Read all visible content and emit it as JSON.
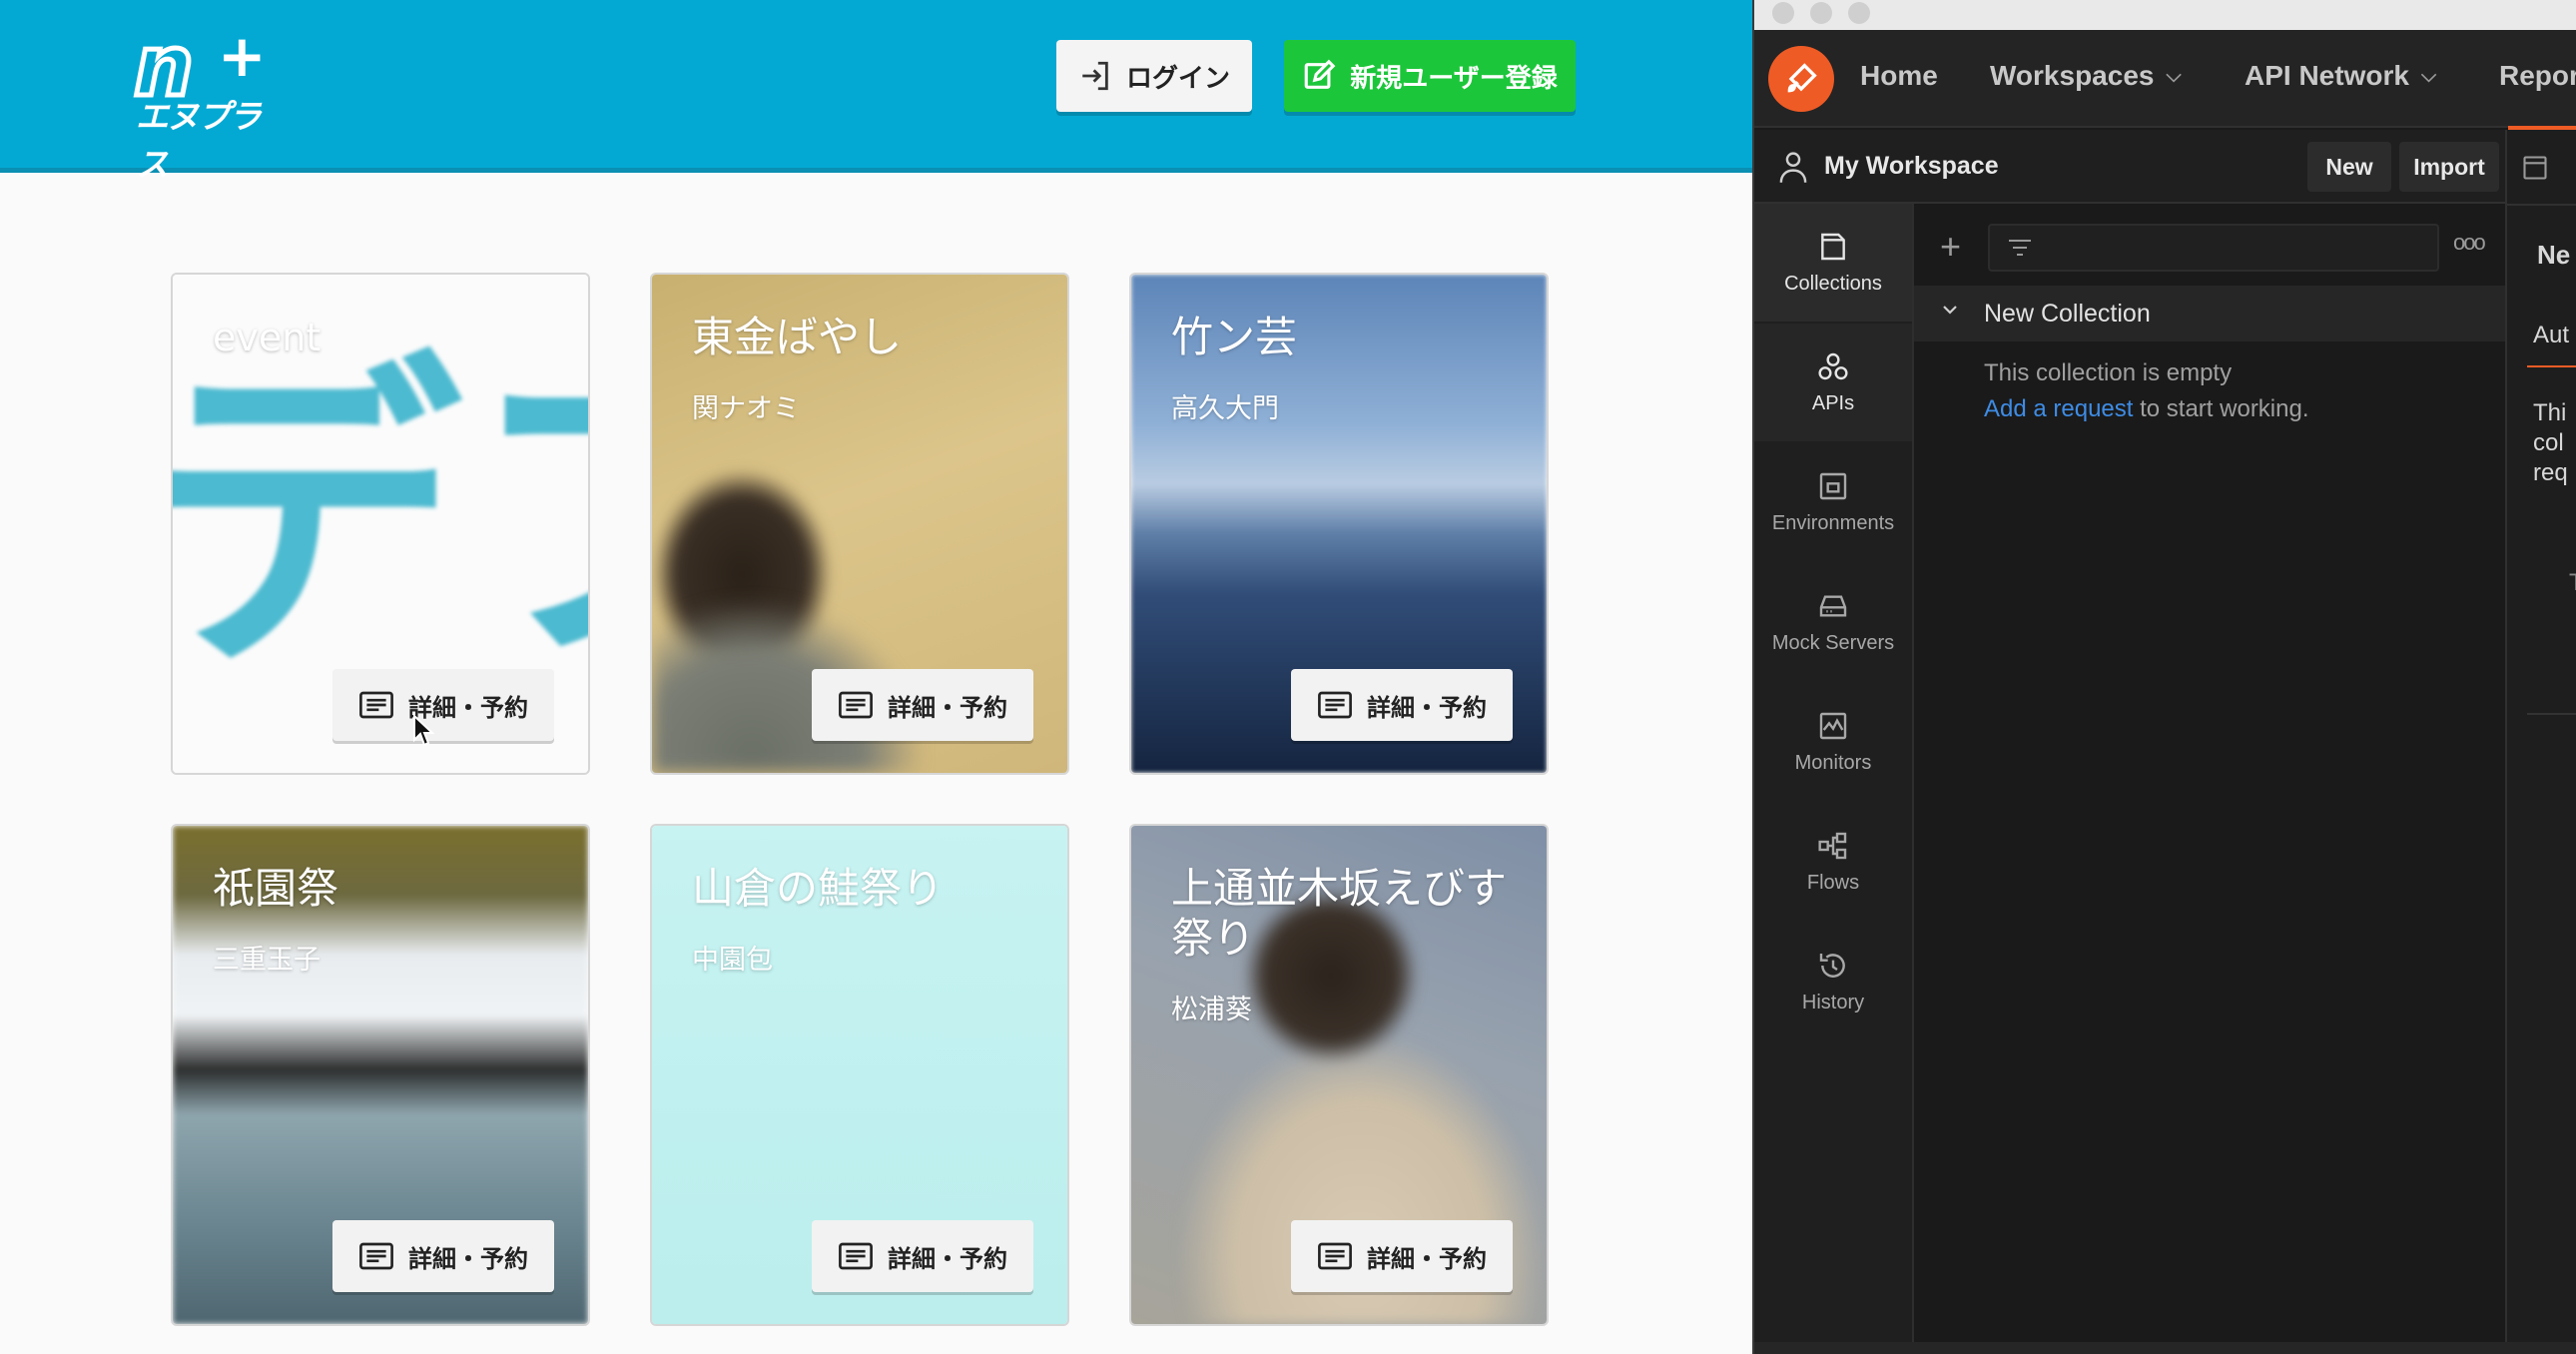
{
  "webapp": {
    "header": {
      "logo_text": "エヌプラス",
      "login_label": "ログイン",
      "register_label": "新規ユーザー登録"
    },
    "cards": [
      {
        "title": "event",
        "subtitle": "",
        "button_label": "詳細・予約"
      },
      {
        "title": "東金ばやし",
        "subtitle": "関ナオミ",
        "button_label": "詳細・予約"
      },
      {
        "title": "竹ン芸",
        "subtitle": "高久大門",
        "button_label": "詳細・予約"
      },
      {
        "title": "祇園祭",
        "subtitle": "三重玉子",
        "button_label": "詳細・予約"
      },
      {
        "title": "山倉の鮭祭り",
        "subtitle": "中園包",
        "button_label": "詳細・予約"
      },
      {
        "title": "上通並木坂えびす祭り",
        "subtitle": "松浦葵",
        "button_label": "詳細・予約"
      }
    ],
    "card1_backdrop_text": "デフォ"
  },
  "postman": {
    "nav": {
      "home": "Home",
      "workspaces": "Workspaces",
      "api_network": "API Network",
      "reports": "Repor"
    },
    "workspace": {
      "name": "My Workspace",
      "new_label": "New",
      "import_label": "Import"
    },
    "sidebar": [
      {
        "label": "Collections",
        "icon": "collections-icon"
      },
      {
        "label": "APIs",
        "icon": "apis-icon"
      },
      {
        "label": "Environments",
        "icon": "environments-icon"
      },
      {
        "label": "Mock Servers",
        "icon": "mock-servers-icon"
      },
      {
        "label": "Monitors",
        "icon": "monitors-icon"
      },
      {
        "label": "Flows",
        "icon": "flows-icon"
      },
      {
        "label": "History",
        "icon": "history-icon"
      }
    ],
    "collection": {
      "name": "New Collection",
      "empty_text": "This collection is empty",
      "add_request_link": "Add a request",
      "add_request_suffix": " to start working."
    },
    "right_panel": {
      "heading": "Ne",
      "tab": "Aut",
      "line1": "Thi",
      "line2": "col",
      "line3": "req",
      "t_letter": "T"
    }
  },
  "colors": {
    "header_blue": "#04a9d3",
    "register_green": "#1cc63a",
    "postman_orange": "#ef5b25",
    "link_blue": "#3e8ce5"
  }
}
